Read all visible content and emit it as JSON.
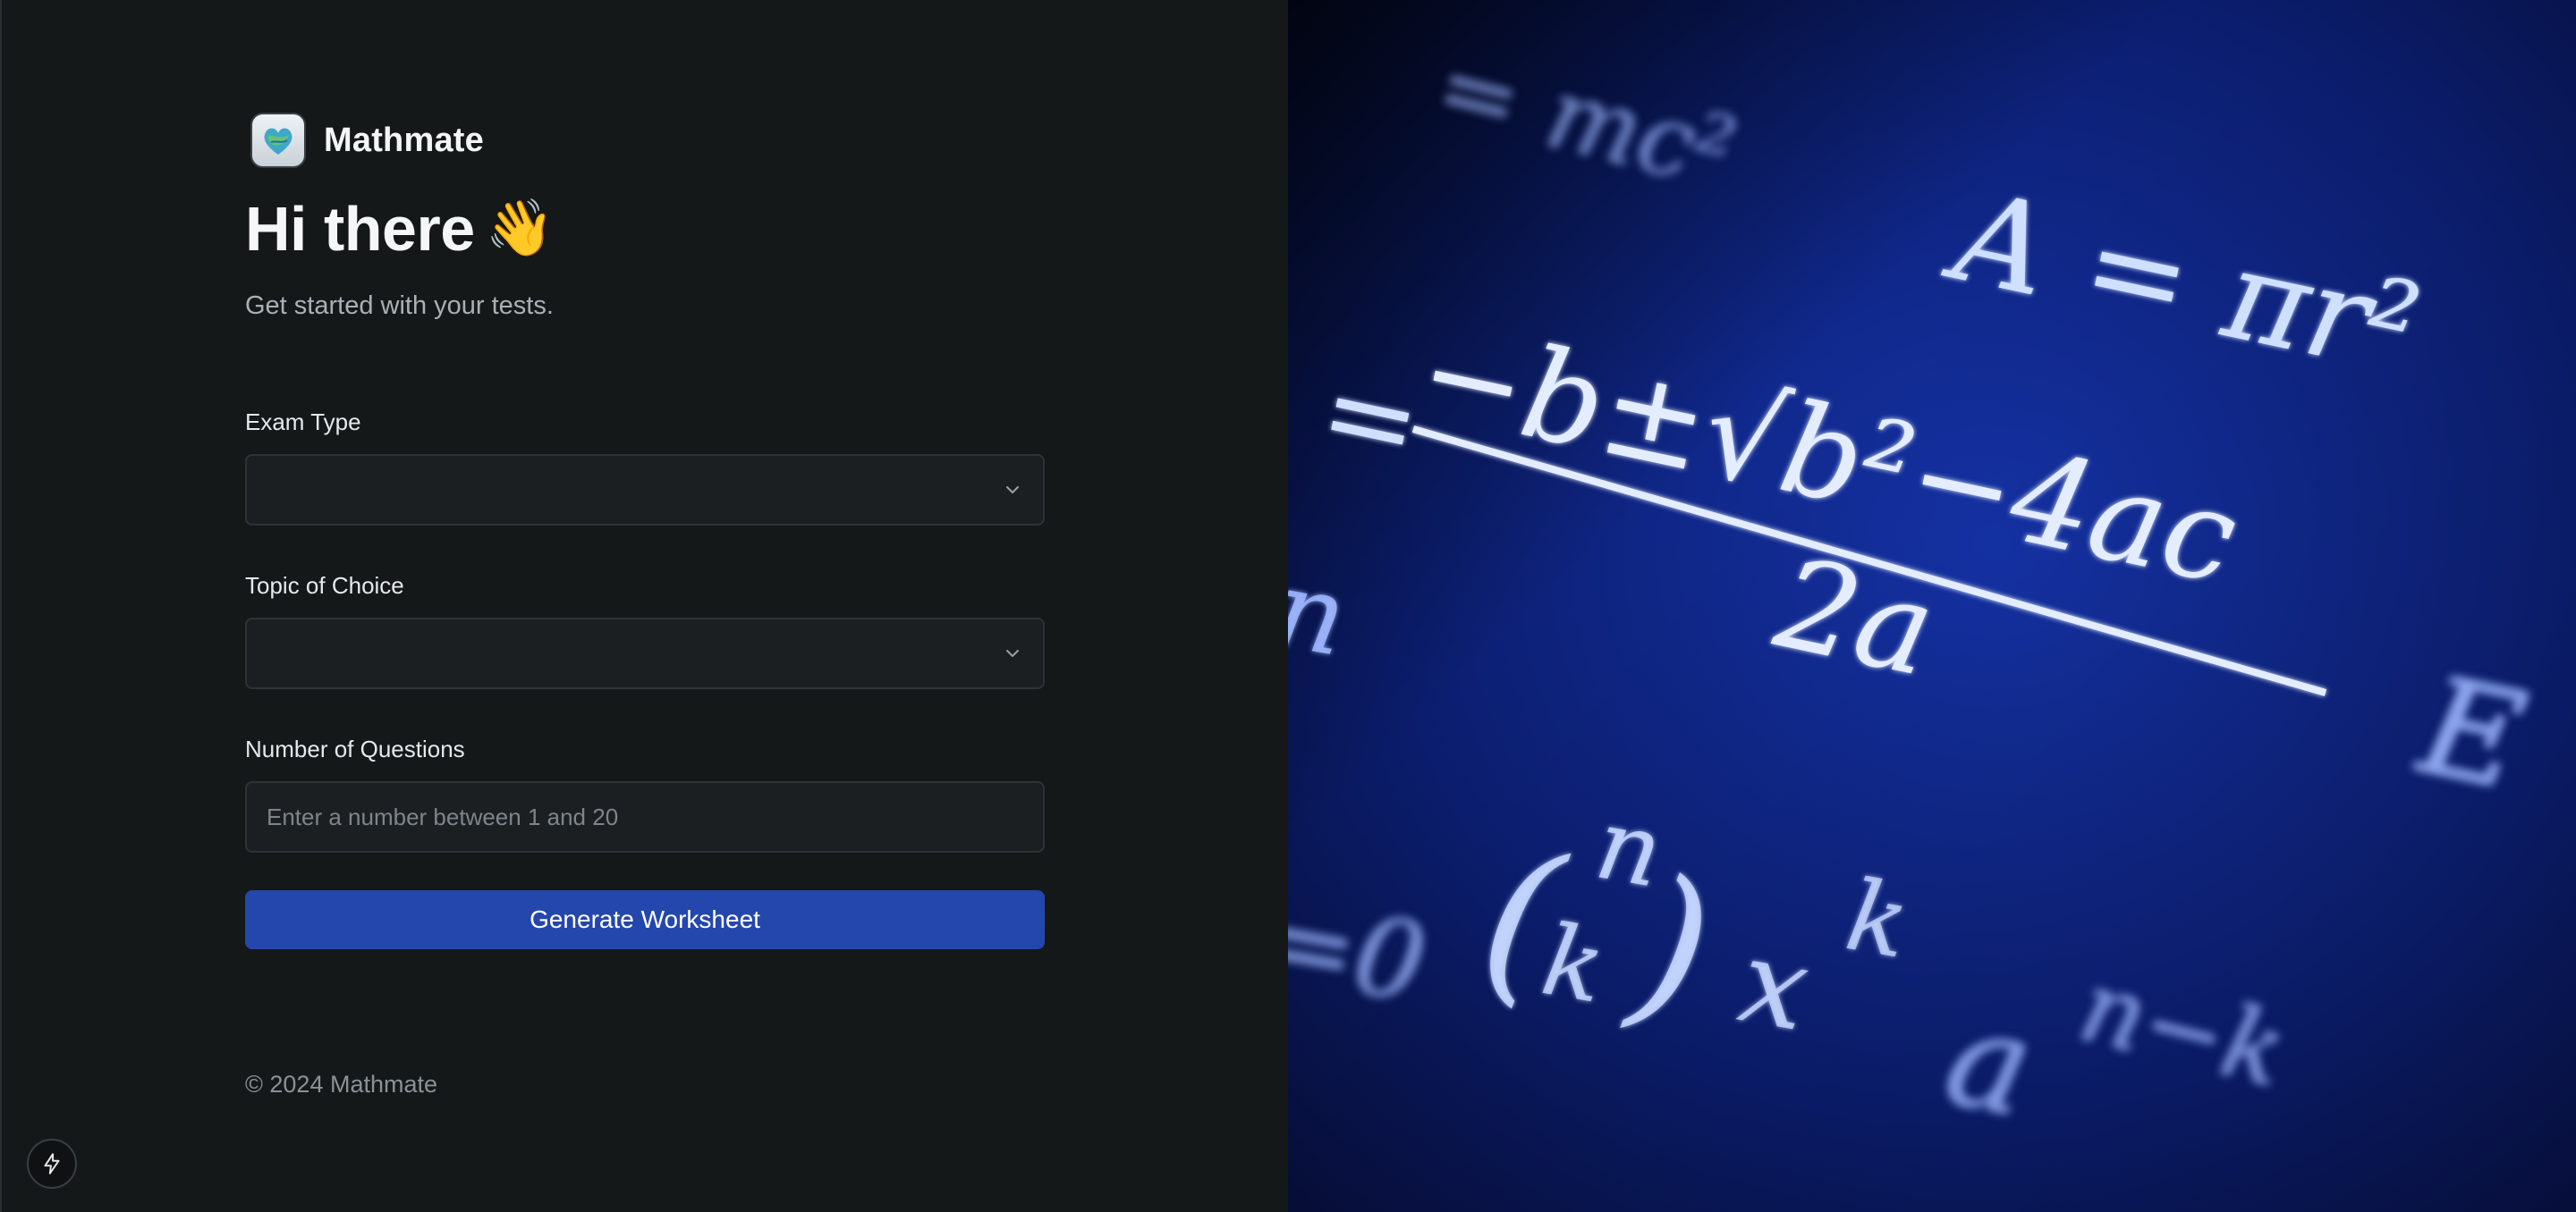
{
  "brand": {
    "name": "Mathmate"
  },
  "greeting": {
    "title": "Hi there",
    "emoji": "👋"
  },
  "subtitle": "Get started with your tests.",
  "form": {
    "exam_type": {
      "label": "Exam Type",
      "value": ""
    },
    "topic": {
      "label": "Topic of Choice",
      "value": ""
    },
    "num_questions": {
      "label": "Number of Questions",
      "placeholder": "Enter a number between 1 and 20"
    },
    "submit_label": "Generate Worksheet"
  },
  "footer": {
    "copyright": "© 2024 Mathmate"
  },
  "hero": {
    "formulas": {
      "emc": "= mc²",
      "circle": "A = πr²",
      "quad_num": "−b±√b²−4ac",
      "quad_eq": "=",
      "quad_den": "2a",
      "binom_n": "n",
      "binom_k": "k",
      "binom_rest": "x",
      "binom_exp": "k",
      "an": "a",
      "an_exp": "n−k",
      "left_n": "n",
      "left_o": "=0",
      "right_e": "E"
    }
  },
  "colors": {
    "accent": "#2447ad",
    "panel": "#151819",
    "field": "#1c1f22"
  },
  "icons": {
    "logo": "mathmate-logo-icon",
    "chevron": "chevron-down-icon",
    "bolt": "bolt-icon"
  }
}
